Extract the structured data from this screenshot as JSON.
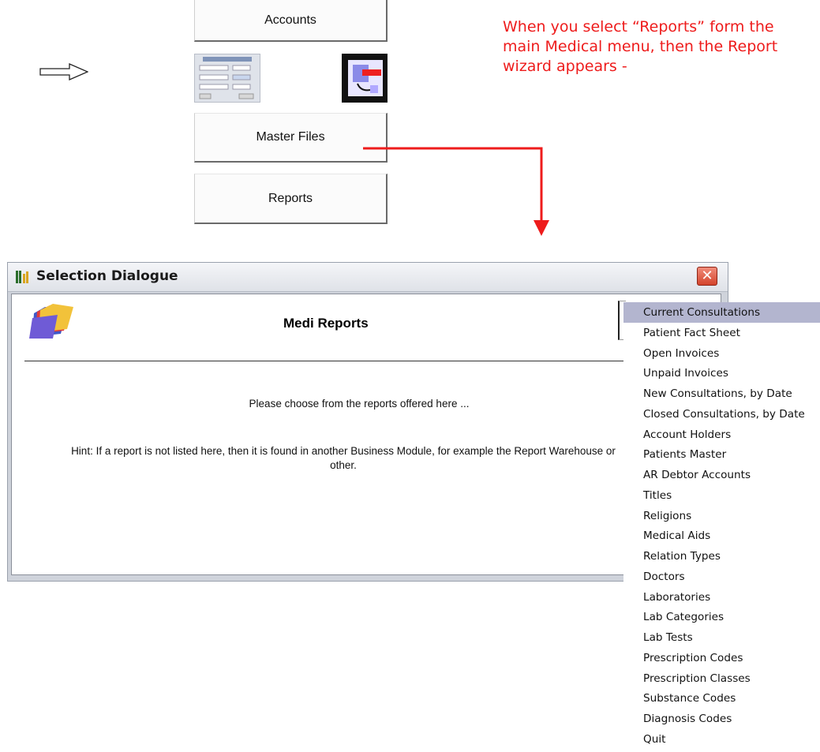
{
  "main_menu": {
    "accounts_label": "Accounts",
    "master_files_label": "Master Files",
    "reports_label": "Reports",
    "arrow_icon": "hollow-right-arrow-icon"
  },
  "annotation": {
    "text": "When you select “Reports” form the main Medical menu, then the Report wizard appears -",
    "color": "#ee1c1c"
  },
  "dialog": {
    "title": "Selection Dialogue",
    "close_glyph": "✕",
    "heading": "Medi Reports",
    "instruction": "Please choose from the reports offered here ...",
    "hint": "Hint: If a report is not listed here, then it is found in another Business Module, for example the Report Warehouse or other."
  },
  "report_list": {
    "selected": "Current Consultations",
    "items": [
      "Current Consultations",
      "Patient Fact Sheet",
      "Open Invoices",
      "Unpaid Invoices",
      "New Consultations, by Date",
      "Closed Consultations, by Date",
      "Account Holders",
      "Patients Master",
      "AR Debtor Accounts",
      "Titles",
      "Religions",
      "Medical Aids",
      "Relation Types",
      "Doctors",
      "Laboratories",
      "Lab Categories",
      "Lab Tests",
      "Prescription Codes",
      "Prescription Classes",
      "Substance Codes",
      "Diagnosis Codes",
      "Quit"
    ]
  }
}
